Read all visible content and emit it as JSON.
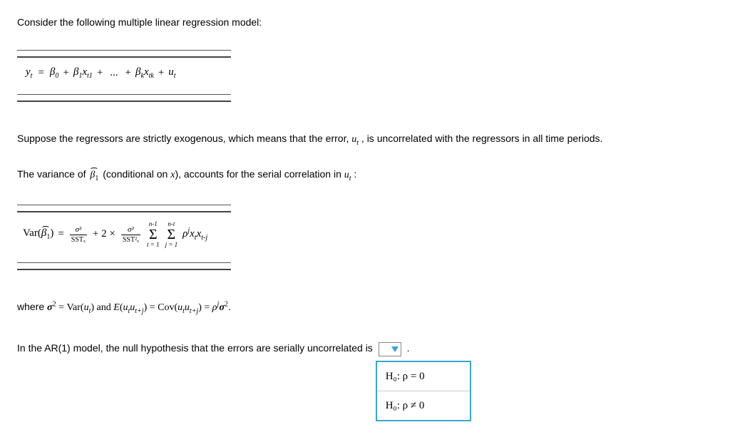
{
  "intro": "Consider the following multiple linear regression model:",
  "eq1": {
    "lhs": "y",
    "lhs_sub": "t",
    "eq": "=",
    "b0": "β",
    "b0_sub": "0",
    "plus": "+",
    "b1": "β",
    "b1_sub": "1",
    "x1": "x",
    "x1_sub": "t1",
    "dots": "...",
    "bk": "β",
    "bk_sub": "k",
    "xk": "x",
    "xk_sub": "tk",
    "u": "u",
    "u_sub": "t"
  },
  "para2a": "Suppose the regressors are strictly exogenous, which means that the error, ",
  "para2_var": "u",
  "para2_var_sub": "t",
  "para2b": " , is uncorrelated with the regressors in all time periods.",
  "para3a": "The variance of ",
  "para3_beta": "β",
  "para3_beta_sub": "1",
  "para3b": " (conditional on ",
  "para3_x": "x",
  "para3c": "), accounts for the serial correlation in ",
  "para3_u": "u",
  "para3_u_sub": "t",
  "para3d": " :",
  "eq2": {
    "var_label": "Var(",
    "beta": "β",
    "beta_sub": "1",
    "close": ")",
    "eq": "=",
    "frac1_num": "σ²",
    "frac1_den": "SSTₓ",
    "plus": "+ 2 ×",
    "frac2_num": "σ²",
    "frac2_den": "SST²ₓ",
    "sigma1_top": "n-1",
    "sigma1_bot": "t = 1",
    "sigma2_top": "n-t",
    "sigma2_bot": "j = 1",
    "rho": "ρ",
    "rho_sup": "j",
    "xt": "x",
    "xt_sub": "t",
    "xtj": "x",
    "xtj_sub": "t-j",
    "sigma_sym": "Σ"
  },
  "para4a": "where ",
  "para4_sigma": "σ",
  "para4_sq": "2",
  "para4_eq1": " = Var(",
  "para4_ut": "u",
  "para4_ut_sub": "t",
  "para4b": ") and ",
  "para4_E": "E",
  "para4c": "(",
  "para4_ut2": "u",
  "para4_ut2_sub": "t",
  "para4_utj": "u",
  "para4_utj_sub": "t+j",
  "para4d": ") = Cov(",
  "para4_ut3": "u",
  "para4_ut3_sub": "t",
  "para4_utj2": "u",
  "para4_utj2_sub": "t+j",
  "para4e": ") = ",
  "para4_rho": "ρ",
  "para4_rho_sup": "j",
  "para4_sigma2": "σ",
  "para4_sq2": "2",
  "para4f": ".",
  "para5": "In the AR(1) model, the null hypothesis that the errors are serially uncorrelated is ",
  "para5_end": " .",
  "dropdown": {
    "options": [
      "H₀: ρ = 0",
      "H₀: ρ ≠ 0"
    ]
  }
}
